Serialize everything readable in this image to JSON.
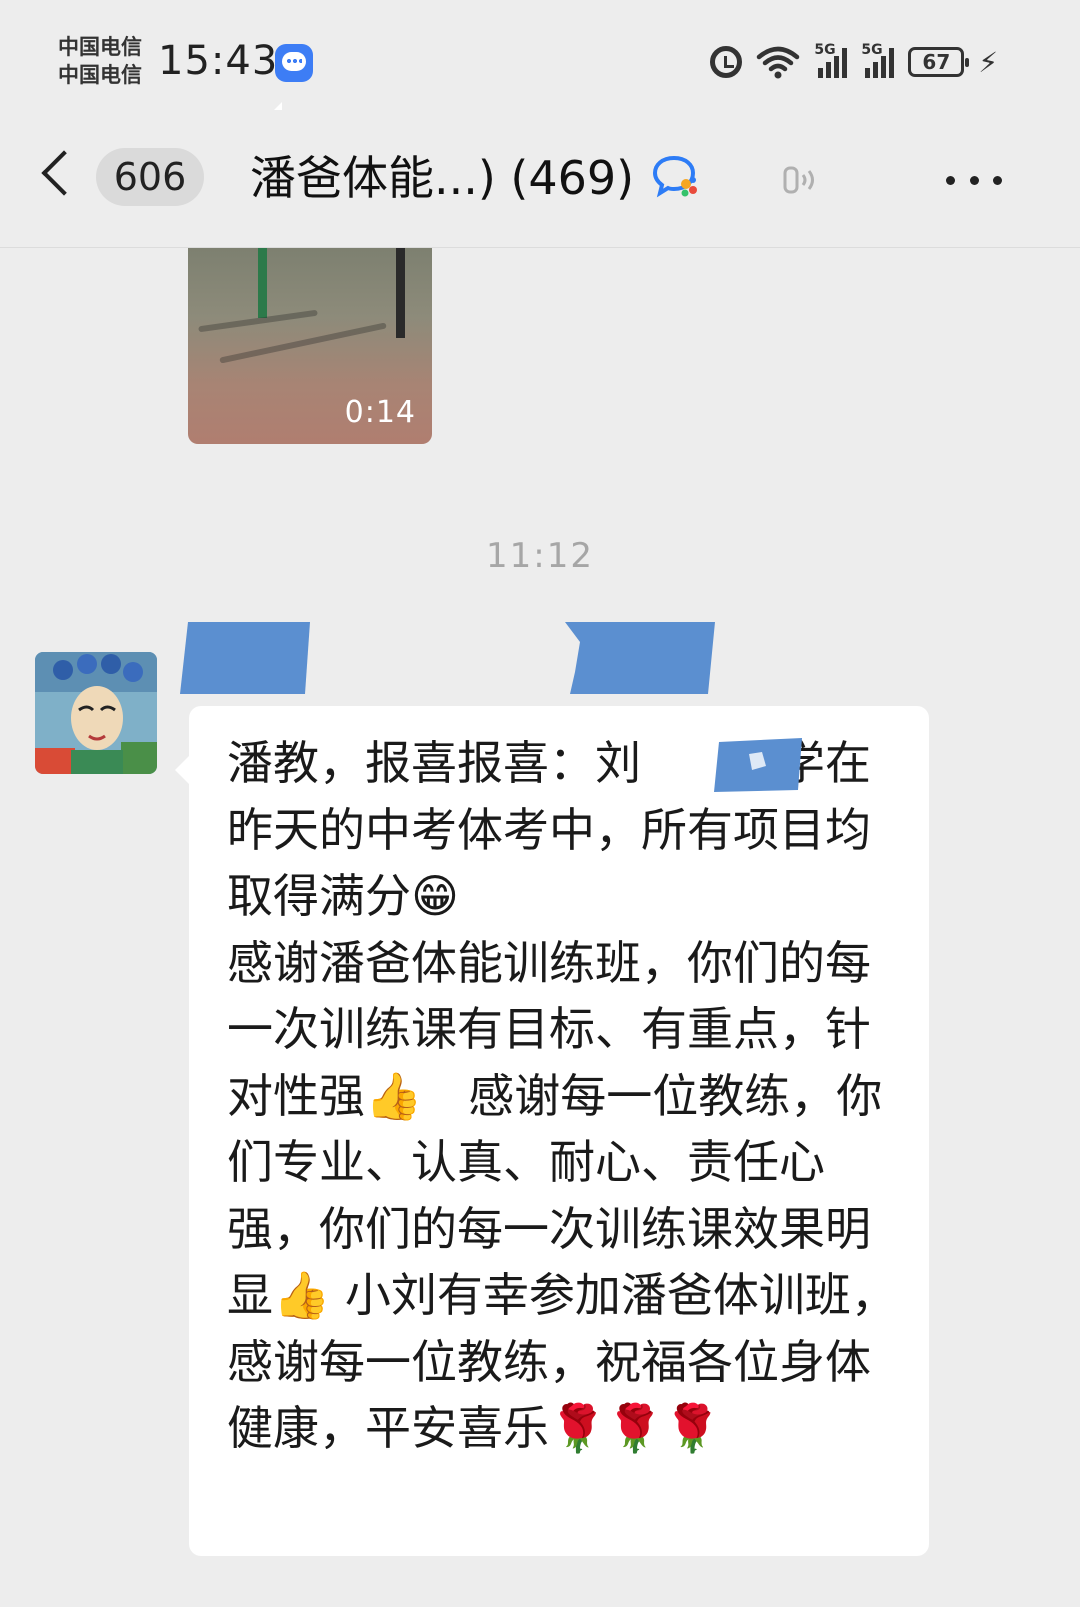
{
  "status_bar": {
    "carrier_1": "中国电信",
    "carrier_2": "中国电信",
    "time": "15:43",
    "signal_label_1": "5G",
    "signal_label_2": "5G",
    "battery": "67",
    "icons": [
      "messages-app-icon",
      "alarm-icon",
      "wifi-icon",
      "signal-icon",
      "battery-icon",
      "charging-icon"
    ]
  },
  "header": {
    "unread_count": "606",
    "title": "潘爸体能...) (469)",
    "icons": [
      "back-icon",
      "group-chat-icon",
      "voice-mode-icon",
      "more-icon"
    ]
  },
  "messages": {
    "video": {
      "duration": "0:14"
    },
    "timestamp": "11:12",
    "text_message": {
      "text": "潘教，报喜报喜：刘　　同学在昨天的中考体考中，所有项目均取得满分😁\n感谢潘爸体能训练班，你们的每一次训练课有目标、有重点，针对性强👍　感谢每一位教练，你们专业、认真、耐心、责任心强，你们的每一次训练课效果明显👍 小刘有幸参加潘爸体训班，感谢每一位教练，祝福各位身体健康，平安喜乐🌹🌹🌹"
    }
  },
  "colors": {
    "background": "#ededed",
    "bubble": "#ffffff",
    "redaction_blue": "#5b8fd0",
    "timestamp": "#a6a6a6"
  }
}
